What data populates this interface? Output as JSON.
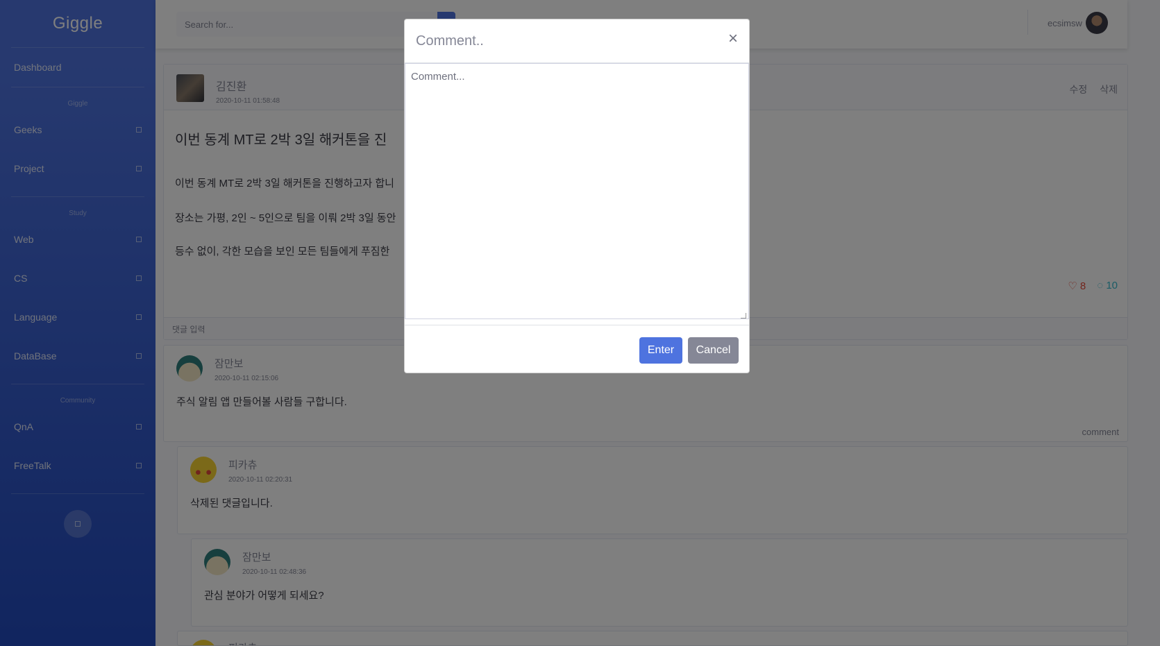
{
  "sidebar": {
    "brand": "Giggle",
    "dashboard": "Dashboard",
    "sections": [
      {
        "heading": "Giggle",
        "items": [
          "Geeks",
          "Project"
        ]
      },
      {
        "heading": "Study",
        "items": [
          "Web",
          "CS",
          "Language",
          "DataBase"
        ]
      },
      {
        "heading": "Community",
        "items": [
          "QnA",
          "FreeTalk"
        ]
      }
    ]
  },
  "topbar": {
    "search_placeholder": "Search for...",
    "username": "ecsimsw"
  },
  "post": {
    "author": "김진환",
    "date": "2020-10-11 01:58:48",
    "edit_label": "수정",
    "delete_label": "삭제",
    "title": "이번 동계 MT로 2박 3일 해커톤을 진",
    "lines": [
      "이번 동계 MT로 2박 3일 해커톤을 진행하고자 합니",
      "장소는 가평, 2인 ~ 5인으로 팀을 이뤄 2박 3일 동안",
      "등수 없이, 각한 모습을 보인 모든 팀들에게 푸짐한"
    ],
    "likes": "8",
    "comments": "10",
    "comment_input_label": "댓글 입력"
  },
  "comments": [
    {
      "name": "잠만보",
      "date": "2020-10-11 02:15:06",
      "text": "주식 알림 앱 만들어볼 사람들 구합니다.",
      "reply_label": "comment"
    },
    {
      "name": "피카츄",
      "date": "2020-10-11 02:20:31",
      "text": "삭제된 댓글입니다."
    },
    {
      "name": "잠만보",
      "date": "2020-10-11 02:48:36",
      "text": "관심 분야가 어떻게 되세요?"
    },
    {
      "name": "피카츄"
    }
  ],
  "modal": {
    "title": "Comment..",
    "close": "×",
    "placeholder": "Comment...",
    "enter_label": "Enter",
    "cancel_label": "Cancel"
  }
}
